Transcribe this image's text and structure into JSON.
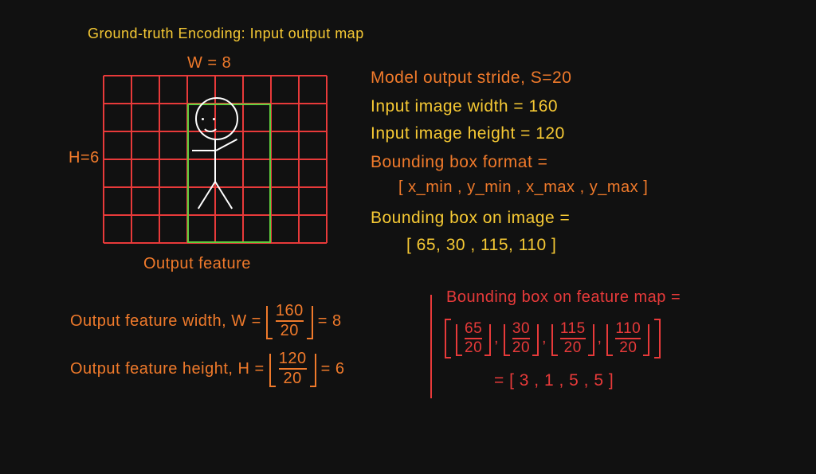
{
  "title": "Ground-truth Encoding: Input output map",
  "grid": {
    "w_label": "W = 8",
    "h_label": "H=6",
    "caption": "Output feature",
    "cols": 8,
    "rows": 6,
    "bbox_on_grid": [
      3,
      1,
      5,
      5
    ]
  },
  "params": {
    "stride_text": "Model output stride, S=20",
    "input_w_text": "Input image width = 160",
    "input_h_text": "Input image height = 120",
    "bbox_format_label": "Bounding box format  =",
    "bbox_format_value": "[ x_min , y_min , x_max , y_max ]",
    "bbox_on_image_label": "Bounding box on image =",
    "bbox_on_image_value": "[ 65, 30 , 115, 110 ]"
  },
  "calc": {
    "out_w_label": "Output feature width, W =",
    "out_w_num": "160",
    "out_w_den": "20",
    "out_w_result": "= 8",
    "out_h_label": "Output feature height, H =",
    "out_h_num": "120",
    "out_h_den": "20",
    "out_h_result": "= 6"
  },
  "bbox_map": {
    "label": "Bounding box on feature map =",
    "terms": [
      {
        "num": "65",
        "den": "20"
      },
      {
        "num": "30",
        "den": "20"
      },
      {
        "num": "115",
        "den": "20"
      },
      {
        "num": "110",
        "den": "20"
      }
    ],
    "result": "= [ 3 , 1 , 5 , 5 ]"
  },
  "values": {
    "S": 20,
    "input_width": 160,
    "input_height": 120,
    "W": 8,
    "H": 6,
    "bbox_image": [
      65,
      30,
      115,
      110
    ],
    "bbox_feature": [
      3,
      1,
      5,
      5
    ]
  }
}
